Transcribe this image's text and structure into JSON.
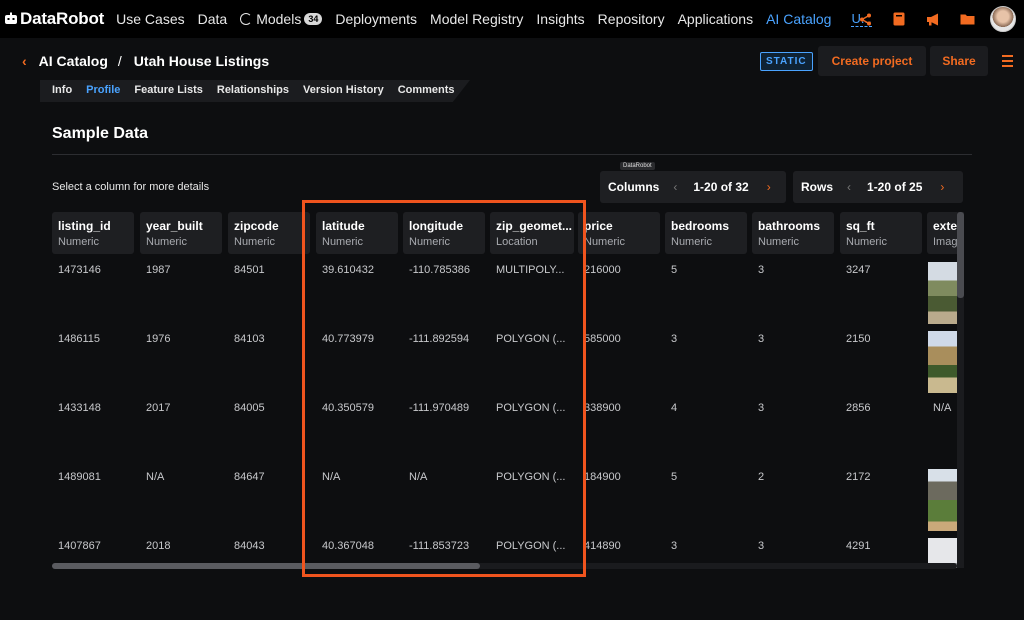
{
  "topnav": {
    "brand": "DataRobot",
    "items": [
      "Use Cases",
      "Data",
      "Models",
      "Deployments",
      "Model Registry",
      "Insights",
      "Repository",
      "Applications",
      "AI Catalog"
    ],
    "models_badge": "34",
    "truncated_item": "U...",
    "icons": [
      "share-icon",
      "notebook-icon",
      "megaphone-icon",
      "folder-icon",
      "user-avatar"
    ]
  },
  "subheader": {
    "back": "‹",
    "crumbs": [
      "AI Catalog",
      "Utah House Listings"
    ],
    "separator": "/",
    "static_badge": "STATIC",
    "create_project": "Create project",
    "share": "Share"
  },
  "tabs": [
    "Info",
    "Profile",
    "Feature Lists",
    "Relationships",
    "Version History",
    "Comments"
  ],
  "section": {
    "title": "Sample Data",
    "hint": "Select a column for more details",
    "tooltip": "DataRobot"
  },
  "pagers": {
    "columns": {
      "label": "Columns",
      "range": "1-20 of 32",
      "prev": "‹",
      "next": "›"
    },
    "rows": {
      "label": "Rows",
      "range": "1-20 of 25",
      "prev": "‹",
      "next": "›"
    }
  },
  "table": {
    "columns": [
      {
        "name": "listing_id",
        "type": "Numeric"
      },
      {
        "name": "year_built",
        "type": "Numeric"
      },
      {
        "name": "zipcode",
        "type": "Numeric"
      },
      {
        "name": "latitude",
        "type": "Numeric"
      },
      {
        "name": "longitude",
        "type": "Numeric"
      },
      {
        "name": "zip_geomet...",
        "type": "Location"
      },
      {
        "name": "price",
        "type": "Numeric"
      },
      {
        "name": "bedrooms",
        "type": "Numeric"
      },
      {
        "name": "bathrooms",
        "type": "Numeric"
      },
      {
        "name": "sq_ft",
        "type": "Numeric"
      },
      {
        "name": "exte",
        "type": "Imag"
      }
    ],
    "rows": [
      [
        "1473146",
        "1987",
        "84501",
        "39.610432",
        "-110.785386",
        "MULTIPOLY...",
        "216000",
        "5",
        "3",
        "3247",
        "img"
      ],
      [
        "1486115",
        "1976",
        "84103",
        "40.773979",
        "-111.892594",
        "POLYGON (...",
        "585000",
        "3",
        "3",
        "2150",
        "img"
      ],
      [
        "1433148",
        "2017",
        "84005",
        "40.350579",
        "-111.970489",
        "POLYGON (...",
        "338900",
        "4",
        "3",
        "2856",
        "N/A"
      ],
      [
        "1489081",
        "N/A",
        "84647",
        "N/A",
        "N/A",
        "POLYGON (...",
        "184900",
        "5",
        "2",
        "2172",
        "img"
      ],
      [
        "1407867",
        "2018",
        "84043",
        "40.367048",
        "-111.853723",
        "POLYGON (...",
        "414890",
        "3",
        "3",
        "4291",
        "img"
      ]
    ]
  },
  "colors": {
    "accent": "#f26b21",
    "link": "#4aa3ff",
    "highlight": "#f0541e"
  }
}
